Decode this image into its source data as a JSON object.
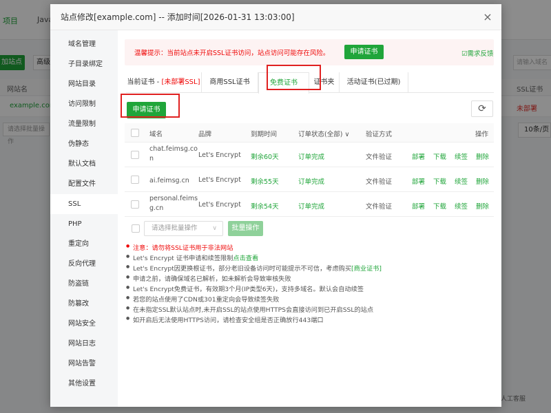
{
  "background": {
    "tabs": [
      "项目",
      "Java"
    ],
    "add_site_label": "加站点",
    "advanced_label": "高级",
    "col_site_name": "网站名",
    "site_name": "example.com",
    "batch_select_placeholder": "请选择批量操作",
    "search_placeholder": "请输入域名",
    "ssl_header": "SSL证书",
    "ssl_value": "未部署",
    "page_size": "10条/页",
    "footer_text": "人工客服"
  },
  "dialog": {
    "title": "站点修改[example.com] -- 添加时间[2026-01-31 13:03:00]",
    "close_label": "×",
    "sidebar": {
      "items": [
        "域名管理",
        "子目录绑定",
        "网站目录",
        "访问限制",
        "流量限制",
        "伪静态",
        "默认文档",
        "配置文件",
        "SSL",
        "PHP",
        "重定向",
        "反向代理",
        "防盗链",
        "防篡改",
        "网站安全",
        "网站日志",
        "网站告警",
        "其他设置"
      ],
      "active_index": 8
    },
    "notice": {
      "text": "温馨提示：当前站点未开启SSL证书访问，站点访问可能存在风险。",
      "apply_label": "申请证书",
      "feedback_label": "需求反馈",
      "feedback_icon": "feedback-check-icon"
    },
    "tabs": {
      "current_prefix": "当前证书 - ",
      "current_status": "[未部署SSL]",
      "commercial": "商用SSL证书",
      "free": "免费证书",
      "folder": "证书夹",
      "activity": "活动证书(已过期)"
    },
    "apply_button": "申请证书",
    "refresh_icon": "refresh-icon",
    "table": {
      "headers": {
        "domain": "域名",
        "brand": "品牌",
        "expire": "到期时间",
        "order_status": "订单状态(全部)",
        "verify": "验证方式",
        "actions": "操作"
      },
      "rows": [
        {
          "domain_line1": "chat.feimsg.co",
          "domain_line2": "n",
          "brand": "Let's Encrypt",
          "expire": "剩余60天",
          "status": "订单完成",
          "verify": "文件验证"
        },
        {
          "domain_line1": "ai.feimsg.cn",
          "domain_line2": "",
          "brand": "Let's Encrypt",
          "expire": "剩余55天",
          "status": "订单完成",
          "verify": "文件验证"
        },
        {
          "domain_line1": "personal.feims",
          "domain_line2": "g.cn",
          "brand": "Let's Encrypt",
          "expire": "剩余54天",
          "status": "订单完成",
          "verify": "文件验证"
        }
      ],
      "actions": [
        "部署",
        "下载",
        "续签",
        "删除"
      ]
    },
    "batch": {
      "placeholder": "请选择批量操作",
      "button": "批量操作"
    },
    "tips": [
      {
        "text": "注意：请勿将SSL证书用于非法网站",
        "red": true
      },
      {
        "pre": "Let's Encrypt 证书申请和续签限制",
        "link": "点击查看",
        "post": ""
      },
      {
        "pre": "Let's Encrypt因更换根证书，部分老旧设备访问时可能提示不可信，考虑购买",
        "link": "[商业证书]",
        "post": ""
      },
      {
        "pre": "申请之前，请确保域名已解析，如未解析会导致审核失败",
        "link": "",
        "post": ""
      },
      {
        "pre": "Let's Encrypt免费证书，有效期3个月(IP类型6天)，支持多域名。默认会自动续签",
        "link": "",
        "post": ""
      },
      {
        "pre": "若您的站点使用了CDN或301重定向会导致续签失败",
        "link": "",
        "post": ""
      },
      {
        "pre": "在未指定SSL默认站点时,未开启SSL的站点使用HTTPS会直接访问到已开启SSL的站点",
        "link": "",
        "post": ""
      },
      {
        "pre": "如开启后无法使用HTTPS访问，请检查安全组是否正确放行443端口",
        "link": "",
        "post": ""
      }
    ]
  },
  "colors": {
    "accent": "#20a53a",
    "danger": "#ef0808",
    "highlight_box": "#e02020"
  }
}
